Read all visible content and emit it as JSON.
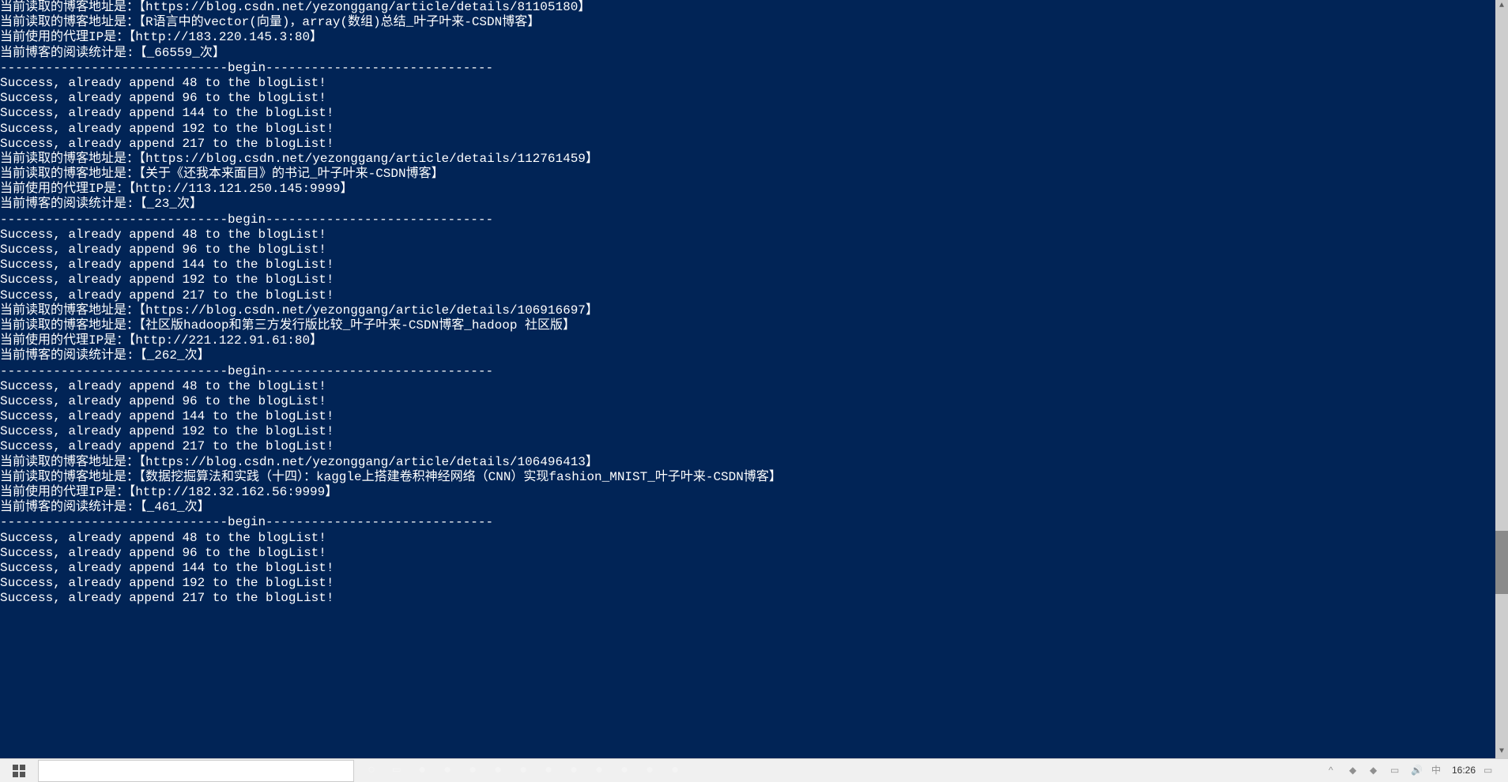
{
  "terminal": {
    "lines": [
      "当前读取的博客地址是：【https://blog.csdn.net/yezonggang/article/details/81105180】",
      "当前读取的博客地址是：【R语言中的vector(向量)，array(数组)总结_叶子叶来-CSDN博客】",
      "当前使用的代理IP是：【http://183.220.145.3:80】",
      "当前博客的阅读统计是:【_66559_次】",
      "------------------------------begin------------------------------",
      "Success, already append 48 to the blogList!",
      "Success, already append 96 to the blogList!",
      "Success, already append 144 to the blogList!",
      "Success, already append 192 to the blogList!",
      "Success, already append 217 to the blogList!",
      "当前读取的博客地址是：【https://blog.csdn.net/yezonggang/article/details/112761459】",
      "当前读取的博客地址是：【关于《还我本来面目》的书记_叶子叶来-CSDN博客】",
      "当前使用的代理IP是：【http://113.121.250.145:9999】",
      "当前博客的阅读统计是:【_23_次】",
      "------------------------------begin------------------------------",
      "Success, already append 48 to the blogList!",
      "Success, already append 96 to the blogList!",
      "Success, already append 144 to the blogList!",
      "Success, already append 192 to the blogList!",
      "Success, already append 217 to the blogList!",
      "当前读取的博客地址是：【https://blog.csdn.net/yezonggang/article/details/106916697】",
      "当前读取的博客地址是：【社区版hadoop和第三方发行版比较_叶子叶来-CSDN博客_hadoop 社区版】",
      "当前使用的代理IP是：【http://221.122.91.61:80】",
      "当前博客的阅读统计是:【_262_次】",
      "------------------------------begin------------------------------",
      "Success, already append 48 to the blogList!",
      "Success, already append 96 to the blogList!",
      "Success, already append 144 to the blogList!",
      "Success, already append 192 to the blogList!",
      "Success, already append 217 to the blogList!",
      "当前读取的博客地址是：【https://blog.csdn.net/yezonggang/article/details/106496413】",
      "当前读取的博客地址是：【数据挖掘算法和实践（十四）：kaggle上搭建卷积神经网络（CNN）实现fashion_MNIST_叶子叶来-CSDN博客】",
      "当前使用的代理IP是：【http://182.32.162.56:9999】",
      "当前博客的阅读统计是:【_461_次】",
      "------------------------------begin------------------------------",
      "Success, already append 48 to the blogList!",
      "Success, already append 96 to the blogList!",
      "Success, already append 144 to the blogList!",
      "Success, already append 192 to the blogList!",
      "Success, already append 217 to the blogList!"
    ]
  },
  "taskbar": {
    "time": "16:26"
  }
}
